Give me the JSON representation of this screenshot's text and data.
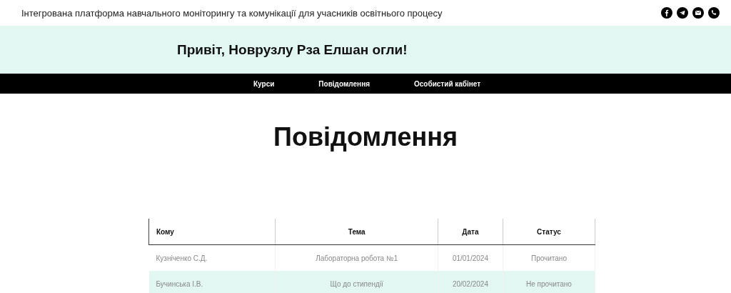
{
  "top_bar": {
    "title": "Інтегрована платформа навчального моніторингу та комунікації для учасників освітнього процесу"
  },
  "banner": {
    "greeting": "Привіт, Новрузлу Рза Елшан огли!"
  },
  "nav": {
    "items": [
      "Курси",
      "Повідомлення",
      "Особистий кабінет"
    ]
  },
  "page_title": "Повідомлення",
  "table": {
    "columns": [
      "Кому",
      "Тема",
      "Дата",
      "Статус"
    ],
    "rows": [
      [
        "Кузніченко С.Д.",
        "Лабораторна робота №1",
        "01/01/2024",
        "Прочитано"
      ],
      [
        "Бучинська І.В.",
        "Що до стипендії",
        "20/02/2024",
        "Не прочитано"
      ]
    ]
  }
}
